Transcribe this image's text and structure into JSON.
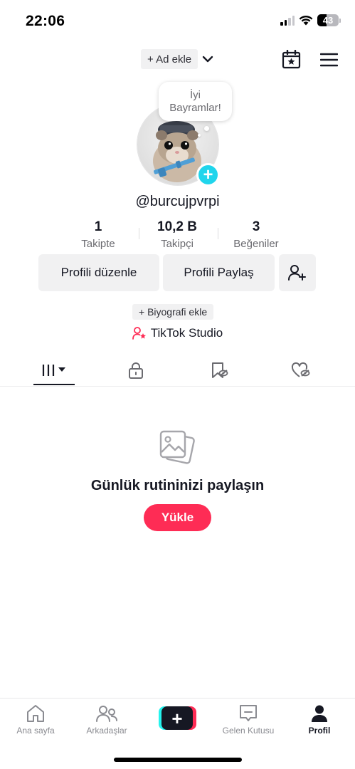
{
  "status_bar": {
    "time": "22:06",
    "battery": "43",
    "battery_level": 0.43
  },
  "header": {
    "add_account_label": "+ Ad ekle"
  },
  "profile": {
    "bubble_line1": "İyi",
    "bubble_line2": "Bayramlar!",
    "username": "@burcujpvrpi",
    "avatar_plus": "+"
  },
  "stats": [
    {
      "value": "1",
      "label": "Takipte"
    },
    {
      "value": "10,2 B",
      "label": "Takipçi"
    },
    {
      "value": "3",
      "label": "Beğeniler"
    }
  ],
  "actions": {
    "edit_label": "Profili düzenle",
    "share_label": "Profili Paylaş"
  },
  "bio_add_label": "+ Biyografi ekle",
  "studio_label": "TikTok Studio",
  "empty_state": {
    "title": "Günlük rutininizi paylaşın",
    "upload_label": "Yükle"
  },
  "bottom_nav": [
    {
      "label": "Ana sayfa",
      "icon": "home-icon"
    },
    {
      "label": "Arkadaşlar",
      "icon": "friends-icon"
    },
    {
      "label": "",
      "icon": "create-icon"
    },
    {
      "label": "Gelen Kutusu",
      "icon": "inbox-icon"
    },
    {
      "label": "Profil",
      "icon": "profile-icon"
    }
  ],
  "colors": {
    "accent": "#fe2c55",
    "cyan": "#20d5ec",
    "text": "#161823",
    "muted": "#6b6b70"
  }
}
